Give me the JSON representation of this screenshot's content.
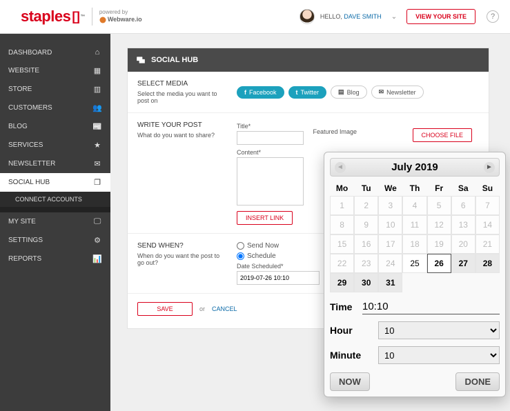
{
  "header": {
    "brand": "staples",
    "powered_by": "powered by",
    "powered_name": "Webware.io",
    "hello": "HELLO,",
    "user_name": "DAVE SMITH",
    "view_site": "VIEW YOUR SITE",
    "help_glyph": "?"
  },
  "sidebar": {
    "items": [
      {
        "label": "DASHBOARD",
        "icon": "⌂"
      },
      {
        "label": "WEBSITE",
        "icon": "▦"
      },
      {
        "label": "STORE",
        "icon": "▥"
      },
      {
        "label": "CUSTOMERS",
        "icon": "👥"
      },
      {
        "label": "BLOG",
        "icon": "📰"
      },
      {
        "label": "SERVICES",
        "icon": "★"
      },
      {
        "label": "NEWSLETTER",
        "icon": "✉"
      },
      {
        "label": "SOCIAL HUB",
        "icon": "❐",
        "active": true
      },
      {
        "label": "CONNECT ACCOUNTS",
        "sub": true
      },
      {
        "label": "MY SITE",
        "icon": "🖵"
      },
      {
        "label": "SETTINGS",
        "icon": "⚙"
      },
      {
        "label": "REPORTS",
        "icon": "📊"
      }
    ]
  },
  "panel": {
    "title": "SOCIAL HUB",
    "select_media": {
      "heading": "SELECT MEDIA",
      "desc": "Select the media you want to post on",
      "chips": [
        {
          "label": "Facebook",
          "selected": true
        },
        {
          "label": "Twitter",
          "selected": true
        },
        {
          "label": "Blog",
          "selected": false
        },
        {
          "label": "Newsletter",
          "selected": false
        }
      ]
    },
    "write_post": {
      "heading": "WRITE YOUR POST",
      "desc": "What do you want to share?",
      "title_label": "Title*",
      "title_value": "",
      "content_label": "Content*",
      "content_value": "",
      "insert_link": "INSERT LINK",
      "featured_heading": "Featured Image",
      "choose_file": "CHOOSE FILE"
    },
    "send_when": {
      "heading": "SEND WHEN?",
      "desc": "When do you want the post to go out?",
      "option_now": "Send Now",
      "option_schedule": "Schedule",
      "selected": "schedule",
      "date_label": "Date Scheduled*",
      "date_value": "2019-07-26 10:10"
    },
    "footer": {
      "save": "SAVE",
      "or": "or",
      "cancel": "CANCEL"
    }
  },
  "datepicker": {
    "title": "July 2019",
    "dow": [
      "Mo",
      "Tu",
      "We",
      "Th",
      "Fr",
      "Sa",
      "Su"
    ],
    "weeks": [
      [
        {
          "d": 1,
          "m": true
        },
        {
          "d": 2,
          "m": true
        },
        {
          "d": 3,
          "m": true
        },
        {
          "d": 4,
          "m": true
        },
        {
          "d": 5,
          "m": true
        },
        {
          "d": 6,
          "m": true
        },
        {
          "d": 7,
          "m": true
        }
      ],
      [
        {
          "d": 8,
          "m": true
        },
        {
          "d": 9,
          "m": true
        },
        {
          "d": 10,
          "m": true
        },
        {
          "d": 11,
          "m": true
        },
        {
          "d": 12,
          "m": true
        },
        {
          "d": 13,
          "m": true
        },
        {
          "d": 14,
          "m": true
        }
      ],
      [
        {
          "d": 15,
          "m": true
        },
        {
          "d": 16,
          "m": true
        },
        {
          "d": 17,
          "m": true
        },
        {
          "d": 18,
          "m": true
        },
        {
          "d": 19,
          "m": true
        },
        {
          "d": 20,
          "m": true
        },
        {
          "d": 21,
          "m": true
        }
      ],
      [
        {
          "d": 22,
          "m": true
        },
        {
          "d": 23,
          "m": true
        },
        {
          "d": 24,
          "m": true
        },
        {
          "d": 25
        },
        {
          "d": 26,
          "today": true
        },
        {
          "d": 27,
          "sel": true
        },
        {
          "d": 28,
          "sel": true
        }
      ],
      [
        {
          "d": 29,
          "sel": true
        },
        {
          "d": 30,
          "sel": true
        },
        {
          "d": 31,
          "sel": true
        }
      ]
    ],
    "time_label": "Time",
    "time_value": "10:10",
    "hour_label": "Hour",
    "hour_value": "10",
    "minute_label": "Minute",
    "minute_value": "10",
    "now": "NOW",
    "done": "DONE"
  }
}
